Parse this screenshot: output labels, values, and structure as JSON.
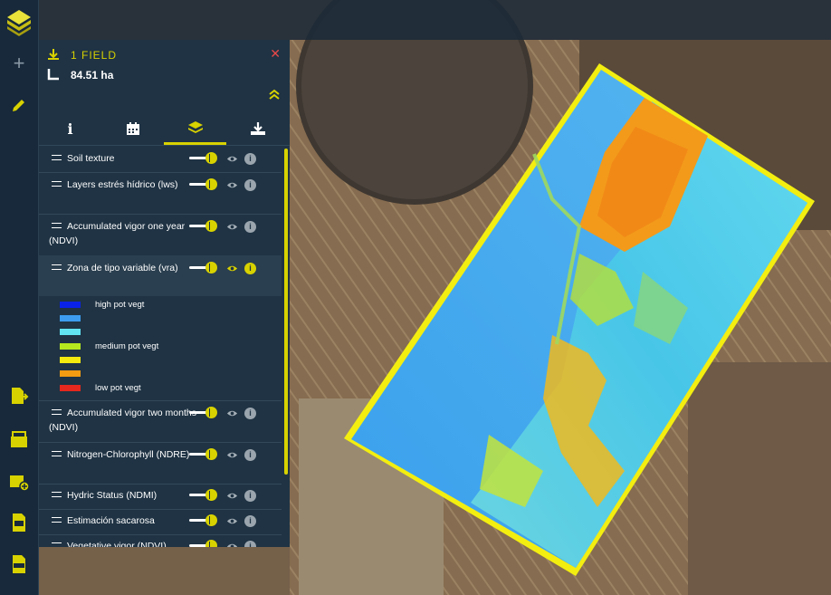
{
  "panel": {
    "title": "1 FIELD",
    "area": "84.51 ha",
    "close_glyph": "✕",
    "collapse_glyph": "⌃",
    "tabs": [
      {
        "icon": "info-icon",
        "glyph": "i"
      },
      {
        "icon": "calendar-icon"
      },
      {
        "icon": "layers-icon"
      },
      {
        "icon": "download-icon"
      }
    ],
    "active_tab": 2
  },
  "layers": [
    {
      "name": "Soil texture",
      "enabled": true
    },
    {
      "name": "Layers estrés hídrico (lws)",
      "enabled": true
    },
    {
      "name": "Accumulated vigor one year (NDVI)",
      "enabled": true
    },
    {
      "name": "Zona de tipo variable (vra)",
      "enabled": true,
      "expanded": true
    },
    {
      "name": "Accumulated vigor two months (NDVI)",
      "enabled": true
    },
    {
      "name": "Nitrogen-Chlorophyll (NDRE)",
      "enabled": true
    },
    {
      "name": "Hydric Status (NDMI)",
      "enabled": true
    },
    {
      "name": "Estimación sacarosa",
      "enabled": true
    },
    {
      "name": "Vegetative vigor (NDVI)",
      "enabled": true
    }
  ],
  "legend": [
    {
      "color": "#0a22e8",
      "label": "high pot vegt"
    },
    {
      "color": "#3d9cf0",
      "label": ""
    },
    {
      "color": "#62e4f2",
      "label": ""
    },
    {
      "color": "#b6ea1e",
      "label": "medium pot vegt"
    },
    {
      "color": "#f4ea0e",
      "label": ""
    },
    {
      "color": "#f49c12",
      "label": ""
    },
    {
      "color": "#e6281e",
      "label": "low pot vegt"
    }
  ],
  "info_glyph": "i",
  "colors": {
    "accent": "#d8d200",
    "panel": "#1f3344",
    "sidebar": "#17293a"
  }
}
